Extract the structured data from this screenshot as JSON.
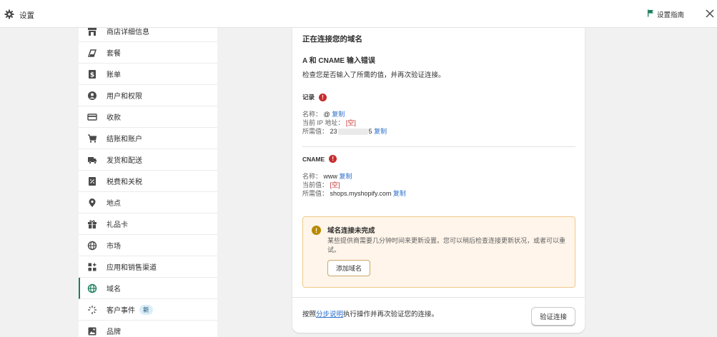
{
  "topbar": {
    "title": "设置",
    "guide_label": "设置指南"
  },
  "sidebar": {
    "items": [
      {
        "label": "商店详细信息",
        "icon": "store-icon"
      },
      {
        "label": "套餐",
        "icon": "plan-icon"
      },
      {
        "label": "账单",
        "icon": "billing-icon"
      },
      {
        "label": "用户和权限",
        "icon": "user-icon"
      },
      {
        "label": "收款",
        "icon": "payments-icon"
      },
      {
        "label": "结账和账户",
        "icon": "cart-icon"
      },
      {
        "label": "发货和配送",
        "icon": "truck-icon"
      },
      {
        "label": "税费和关税",
        "icon": "tax-icon"
      },
      {
        "label": "地点",
        "icon": "location-icon"
      },
      {
        "label": "礼品卡",
        "icon": "gift-icon"
      },
      {
        "label": "市场",
        "icon": "globe-icon"
      },
      {
        "label": "应用和销售渠道",
        "icon": "apps-icon"
      },
      {
        "label": "域名",
        "icon": "domain-icon"
      },
      {
        "label": "客户事件",
        "icon": "sparkle-icon",
        "badge": "新"
      },
      {
        "label": "品牌",
        "icon": "brand-icon"
      }
    ],
    "active_index": 12
  },
  "card": {
    "heading": "正在连接您的域名",
    "subheading": "A 和 CNAME 输入错误",
    "description": "检查您是否输入了所需的值，并再次验证连接。",
    "a_record": {
      "label": "记录",
      "name_key": "名称：",
      "name_value": "@",
      "current_key": "当前 IP 地址：",
      "current_value": "[空]",
      "required_key": "所需值：",
      "required_value_start": "23",
      "required_value_end": "5",
      "copy_label": "复制"
    },
    "cname": {
      "label": "CNAME",
      "name_key": "名称：",
      "name_value": "www",
      "current_key": "当前值：",
      "current_value": "[空]",
      "required_key": "所需值：",
      "required_value": "shops.myshopify.com",
      "copy_label": "复制"
    },
    "warning": {
      "title": "域名连接未完成",
      "body": "某些提供商需要几分钟时间来更新设置。您可以稍后检查连接更新状况，或者可以重试。",
      "button": "添加域名"
    },
    "footer": {
      "prefix": "按照",
      "link": "分步说明",
      "suffix": "执行操作并再次验证您的连接。",
      "verify_button": "验证连接"
    }
  },
  "colors": {
    "error": "#c72c2c",
    "link": "#2c6ecb",
    "warning_bg": "#fff5ea",
    "active_accent": "#1a7f5a"
  }
}
